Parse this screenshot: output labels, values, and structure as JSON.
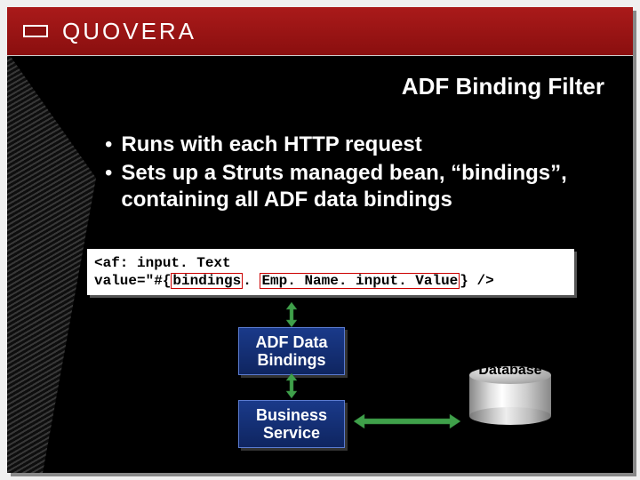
{
  "brand": "QUOVERA",
  "title": "ADF Binding Filter",
  "bullets": [
    "Runs with each HTTP request",
    "Sets up a Struts managed bean, “bindings”, containing all ADF data bindings"
  ],
  "code": {
    "prefix": "<af: input. Text",
    "line2_a": "   value=\"#{",
    "hl1": "bindings",
    "line2_b": ". ",
    "hl2": "Emp. Name. input. Value",
    "line2_c": "} />"
  },
  "diagram": {
    "adf_box": "ADF Data Bindings",
    "bs_box": "Business Service",
    "db_label": "Database"
  }
}
